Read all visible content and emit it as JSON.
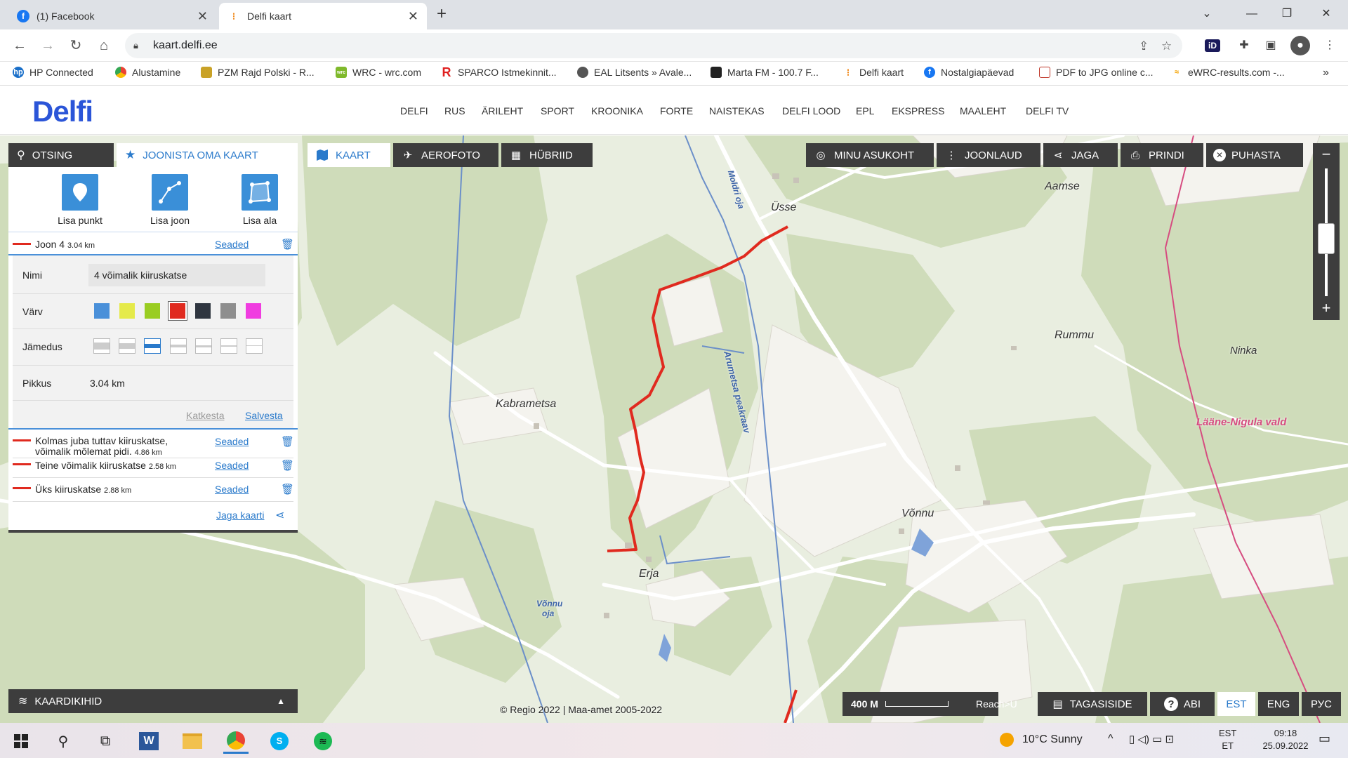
{
  "browser": {
    "tabs": [
      {
        "title": "(1) Facebook",
        "active": false
      },
      {
        "title": "Delfi kaart",
        "active": true
      }
    ],
    "new_tab": "+",
    "url": "kaart.delfi.ee",
    "bookmarks": [
      {
        "label": "HP Connected",
        "icon": "hp-icon",
        "color": "#1a6fc9"
      },
      {
        "label": "Alustamine",
        "icon": "chrome-icon",
        "color": "#dd4b39"
      },
      {
        "label": "PZM Rajd Polski - R...",
        "icon": "pzm-icon",
        "color": "#c9a227"
      },
      {
        "label": "WRC - wrc.com",
        "icon": "wrc-icon",
        "color": "#7fb92b"
      },
      {
        "label": "SPARCO Istmekinnit...",
        "icon": "sparco-icon",
        "color": "#e02020"
      },
      {
        "label": "EAL Litsents » Avale...",
        "icon": "eal-icon",
        "color": "#555555"
      },
      {
        "label": "Marta FM - 100.7 F...",
        "icon": "marta-icon",
        "color": "#222222"
      },
      {
        "label": "Delfi kaart",
        "icon": "delfi-icon",
        "color": "#f08a1c"
      },
      {
        "label": "Nostalgiapäevad",
        "icon": "facebook-icon",
        "color": "#1877f2"
      },
      {
        "label": "PDF to JPG online c...",
        "icon": "pdf-icon",
        "color": "#c0392b"
      },
      {
        "label": "eWRC-results.com -...",
        "icon": "ewrc-icon",
        "color": "#f5a300"
      }
    ],
    "more_bookmarks": "»"
  },
  "site": {
    "logo": "Delfi",
    "nav": [
      "DELFI",
      "RUS",
      "ÄRILEHT",
      "SPORT",
      "KROONIKA",
      "FORTE",
      "NAISTEKAS",
      "DELFI LOOD",
      "EPL",
      "EKSPRESS",
      "MAALEHT",
      "DELFI TV"
    ]
  },
  "panel": {
    "tabs": [
      "OTSING",
      "JOONISTA OMA KAART"
    ],
    "tools": [
      "Lisa punkt",
      "Lisa joon",
      "Lisa ala"
    ],
    "current": {
      "name": "Joon 4",
      "length": "3.04 km",
      "settings": "Seaded"
    },
    "form": {
      "name_label": "Nimi",
      "name_value": "4 võimalik kiiruskatse",
      "color_label": "Värv",
      "colors": [
        "#4a90d9",
        "#e5ea4a",
        "#9acd22",
        "#e02a1f",
        "#2f3640",
        "#8e8e8e",
        "#f03ce0"
      ],
      "selected_color": "#e02a1f",
      "thickness_label": "Jämedus",
      "length_label": "Pikkus",
      "length_value": "3.04 km",
      "cancel": "Katkesta",
      "save": "Salvesta"
    },
    "lines": [
      {
        "name": "Kolmas juba tuttav kiiruskatse,",
        "name2": "võimalik mõlemat pidi.",
        "length": "4.86 km",
        "settings": "Seaded"
      },
      {
        "name": "Teine võimalik kiiruskatse",
        "length": "2.58 km",
        "settings": "Seaded"
      },
      {
        "name": "Üks kiiruskatse",
        "length": "2.88 km",
        "settings": "Seaded"
      }
    ],
    "share": "Jaga kaarti"
  },
  "map": {
    "view_buttons": [
      "KAART",
      "AEROFOTO",
      "HÜBRIID"
    ],
    "action_buttons": [
      "MINU ASUKOHT",
      "JOONLAUD",
      "JAGA",
      "PRINDI",
      "PUHASTA"
    ],
    "zoom_out": "−",
    "zoom_in": "+",
    "labels": {
      "usse": "Üsse",
      "aamse": "Aamse",
      "rummu": "Rummu",
      "ninka": "Ninka",
      "vald": "Lääne-Nigula vald",
      "kabrametsa": "Kabrametsa",
      "vonnu": "Võnnu",
      "erja": "Erja",
      "moldri": "Moldri oja",
      "arumetsa": "Arumetsa peakraav",
      "vonnu_oja1": "Võnnu",
      "vonnu_oja2": "oja"
    },
    "layers": "KAARDIKIHID",
    "scale": "400 M",
    "reach": "Reach>U",
    "feedback": "TAGASISIDE",
    "help": "ABI",
    "langs": [
      "EST",
      "ENG",
      "РУС"
    ],
    "copyright": "© Regio 2022 | Maa-amet 2005-2022"
  },
  "taskbar": {
    "weather": "10°C  Sunny",
    "lang1": "EST",
    "lang2": "ET",
    "time": "09:18",
    "date": "25.09.2022"
  }
}
